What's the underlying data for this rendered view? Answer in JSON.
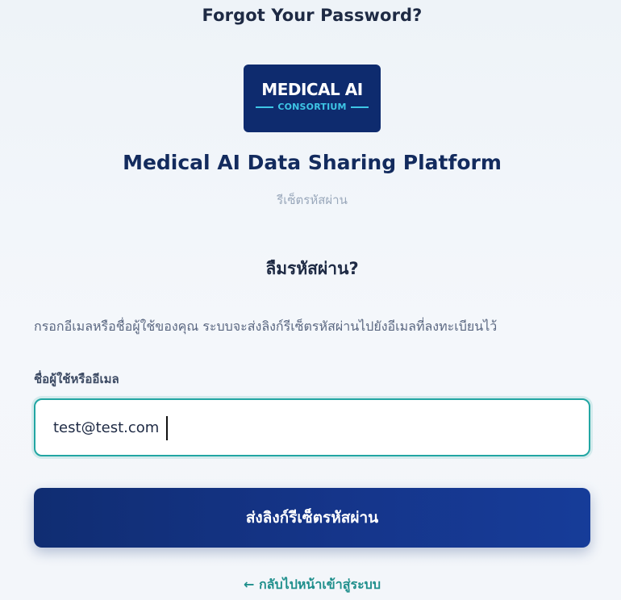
{
  "header": {
    "title": "Forgot Your Password?"
  },
  "logo": {
    "main_text": "MEDICAL AI",
    "sub_text": "CONSORTIUM"
  },
  "platform": {
    "title": "Medical AI Data Sharing Platform",
    "subtitle": "รีเซ็ตรหัสผ่าน"
  },
  "form": {
    "heading": "ลืมรหัสผ่าน?",
    "instructions": "กรอกอีเมลหรือชื่อผู้ใช้ของคุณ ระบบจะส่งลิงก์รีเซ็ตรหัสผ่านไปยังอีเมลที่ลงทะเบียนไว้",
    "username_label": "ชื่อผู้ใช้หรืออีเมล",
    "username_value": "test@test.com",
    "submit_label": "ส่งลิงก์รีเซ็ตรหัสผ่าน",
    "back_link": "← กลับไปหน้าเข้าสู่ระบบ"
  },
  "colors": {
    "brand_navy": "#0e2b6e",
    "accent_teal": "#22a6a3",
    "logo_cyan": "#3ec6e6"
  }
}
